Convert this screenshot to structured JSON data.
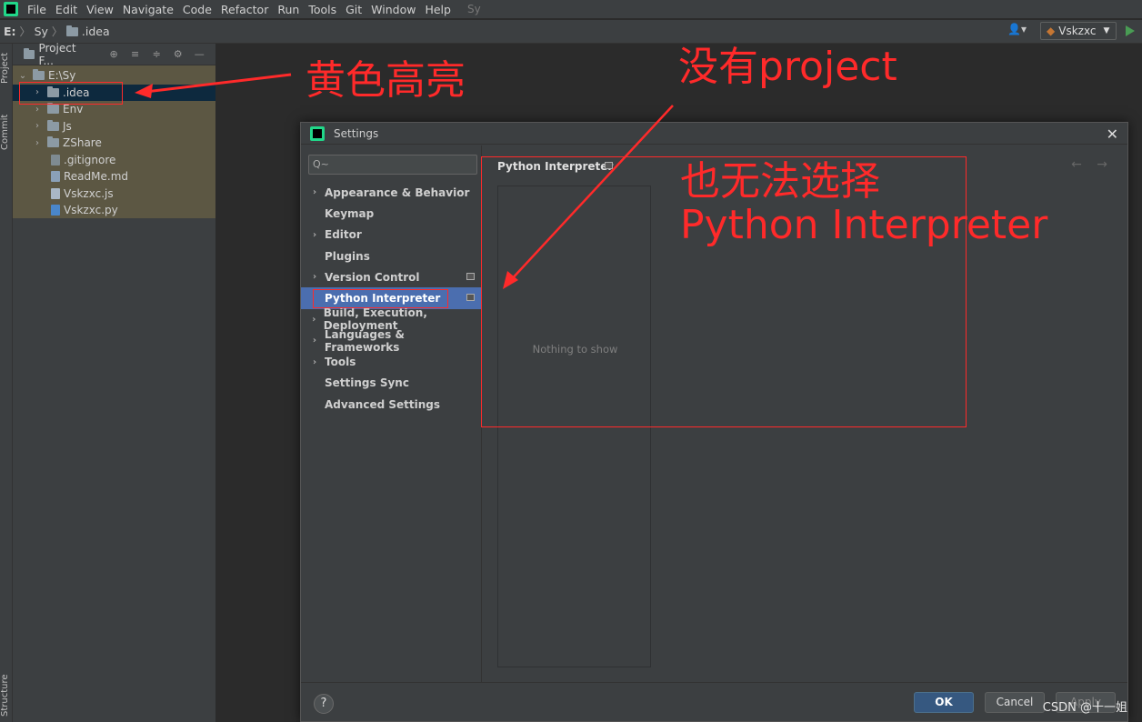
{
  "menubar": {
    "items": [
      "File",
      "Edit",
      "View",
      "Navigate",
      "Code",
      "Refactor",
      "Run",
      "Tools",
      "Git",
      "Window",
      "Help"
    ],
    "project_hint": "Sy"
  },
  "navbar": {
    "drive": "E:",
    "crumb1": "Sy",
    "crumb2": ".idea",
    "run_config": "Vskzxc"
  },
  "stripe": {
    "project": "Project",
    "commit": "Commit",
    "structure": "Structure"
  },
  "project_panel": {
    "title": "Project F...",
    "root": "E:\\Sy",
    "items": [
      ".idea",
      "Env",
      "Js",
      "ZShare",
      ".gitignore",
      "ReadMe.md",
      "Vskzxc.js",
      "Vskzxc.py"
    ]
  },
  "dialog": {
    "title": "Settings",
    "search_placeholder": "Q~",
    "sidebar": [
      "Appearance & Behavior",
      "Keymap",
      "Editor",
      "Plugins",
      "Version Control",
      "Python Interpreter",
      "Build, Execution, Deployment",
      "Languages & Frameworks",
      "Tools",
      "Settings Sync",
      "Advanced Settings"
    ],
    "main_title": "Python Interpreter",
    "empty_text": "Nothing to show",
    "nav_arrows": "← →",
    "help": "?",
    "ok": "OK",
    "cancel": "Cancel",
    "apply": "Apply"
  },
  "annotations": {
    "yellow_highlight": "黄色高亮",
    "no_project": "没有project",
    "cannot_select_line1": "也无法选择",
    "cannot_select_line2": "Python Interpreter",
    "watermark": "CSDN @十一姐"
  }
}
